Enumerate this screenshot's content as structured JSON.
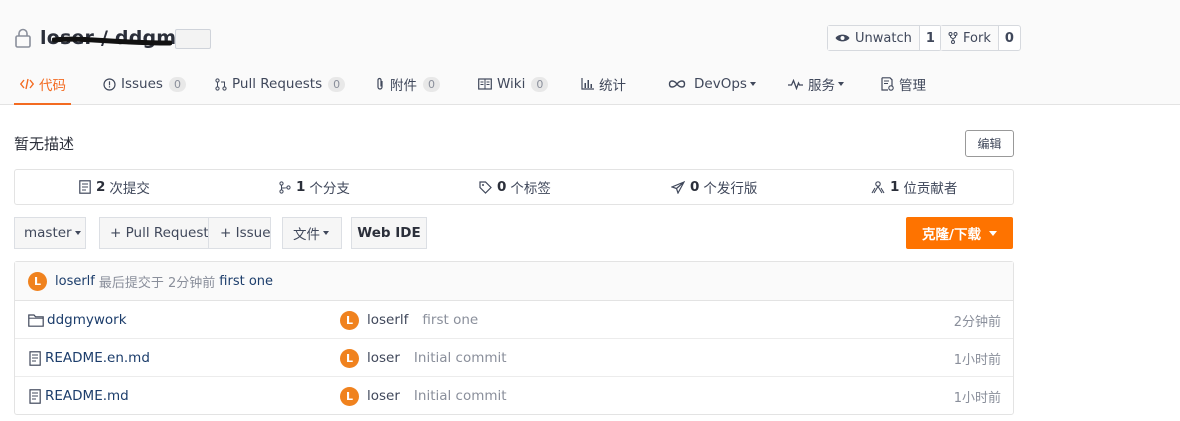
{
  "repo": {
    "name": "loser / ddgmy"
  },
  "header_buttons": {
    "watch": {
      "label": "Unwatch",
      "count": "1"
    },
    "fork": {
      "label": "Fork",
      "count": "0"
    }
  },
  "tabs": [
    {
      "label": "代码",
      "icon": "code-icon",
      "active": true
    },
    {
      "label": "Issues",
      "badge": "0",
      "icon": "issue-icon"
    },
    {
      "label": "Pull Requests",
      "badge": "0",
      "icon": "pull-request-icon"
    },
    {
      "label": "附件",
      "badge": "0",
      "icon": "paperclip-icon"
    },
    {
      "label": "Wiki",
      "badge": "0",
      "icon": "book-icon"
    },
    {
      "label": "统计",
      "icon": "bar-chart-icon"
    },
    {
      "label": "DevOps",
      "icon": "infinity-icon",
      "dropdown": true
    },
    {
      "label": "服务",
      "icon": "pulse-icon",
      "dropdown": true
    },
    {
      "label": "管理",
      "icon": "settings-doc-icon"
    }
  ],
  "description": "暂无描述",
  "edit_label": "编辑",
  "stats": [
    {
      "count": "2",
      "label": "次提交",
      "icon": "commit-doc-icon"
    },
    {
      "count": "1",
      "label": "个分支",
      "icon": "branch-icon"
    },
    {
      "count": "0",
      "label": "个标签",
      "icon": "tag-icon"
    },
    {
      "count": "0",
      "label": "个发行版",
      "icon": "send-icon"
    },
    {
      "count": "1",
      "label": "位贡献者",
      "icon": "contributors-icon"
    }
  ],
  "toolbar": {
    "branch": "master",
    "pull_request": "+ Pull Request",
    "issue": "+ Issue",
    "file": "文件",
    "web_ide": "Web IDE",
    "clone": "克隆/下载"
  },
  "accent_color": "#fe7300",
  "last_commit": {
    "avatar": "L",
    "author": "loserlf",
    "text": "最后提交于 2分钟前",
    "message": "first one"
  },
  "files": [
    {
      "name": "ddgmywork",
      "type": "folder",
      "avatar": "L",
      "author": "loserlf",
      "message": "first one",
      "time": "2分钟前"
    },
    {
      "name": "README.en.md",
      "type": "file",
      "avatar": "L",
      "author": "loser",
      "message": "Initial commit",
      "time": "1小时前"
    },
    {
      "name": "README.md",
      "type": "file",
      "avatar": "L",
      "author": "loser",
      "message": "Initial commit",
      "time": "1小时前"
    }
  ]
}
